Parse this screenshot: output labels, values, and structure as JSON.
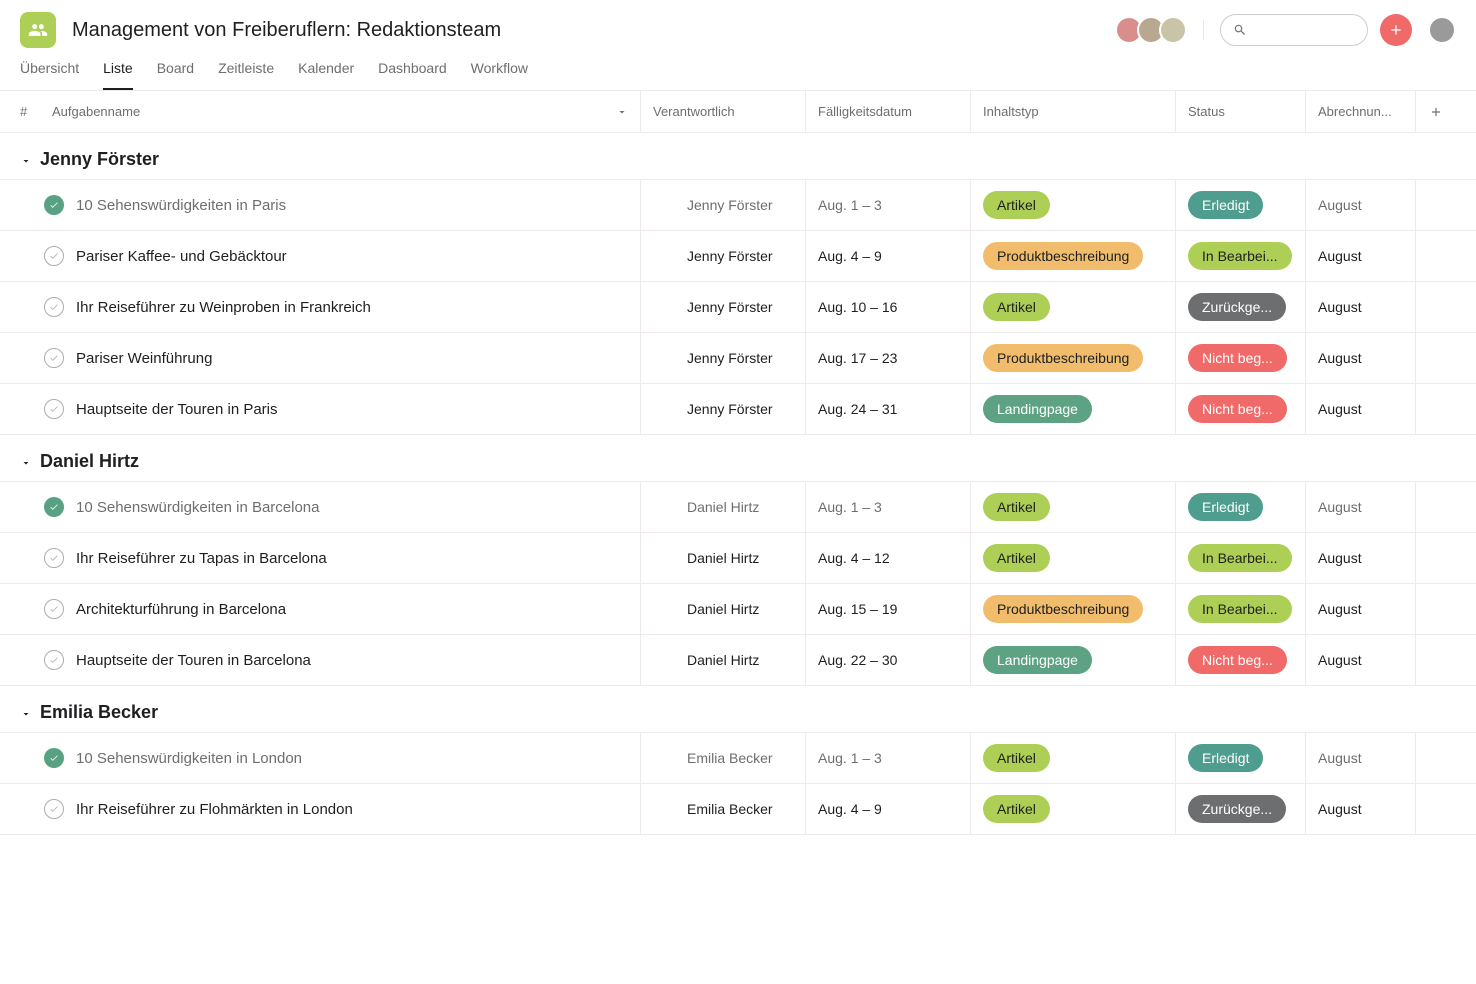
{
  "project": {
    "title": "Management von Freiberuflern: Redaktionsteam"
  },
  "tabs": [
    {
      "label": "Übersicht"
    },
    {
      "label": "Liste"
    },
    {
      "label": "Board"
    },
    {
      "label": "Zeitleiste"
    },
    {
      "label": "Kalender"
    },
    {
      "label": "Dashboard"
    },
    {
      "label": "Workflow"
    }
  ],
  "columns": {
    "hash": "#",
    "name": "Aufgabenname",
    "responsible": "Verantwortlich",
    "due": "Fälligkeitsdatum",
    "content": "Inhaltstyp",
    "status": "Status",
    "billing": "Abrechnun..."
  },
  "sections": [
    {
      "name": "Jenny Förster",
      "avatar_class": "av-jenny",
      "tasks": [
        {
          "done": true,
          "name": "10 Sehenswürdigkeiten in Paris",
          "assignee": "Jenny Förster",
          "due": "Aug. 1 – 3",
          "content_type": "Artikel",
          "content_class": "artikel",
          "status": "Erledigt",
          "status_class": "erledigt",
          "billing": "August"
        },
        {
          "done": false,
          "name": "Pariser Kaffee- und Gebäcktour",
          "assignee": "Jenny Förster",
          "due": "Aug. 4 – 9",
          "content_type": "Produktbeschreibung",
          "content_class": "produkt",
          "status": "In Bearbei...",
          "status_class": "bearbeitung",
          "billing": "August"
        },
        {
          "done": false,
          "name": "Ihr Reiseführer zu Weinproben in Frankreich",
          "assignee": "Jenny Förster",
          "due": "Aug. 10 – 16",
          "content_type": "Artikel",
          "content_class": "artikel",
          "status": "Zurückge...",
          "status_class": "zurueck",
          "billing": "August"
        },
        {
          "done": false,
          "name": "Pariser Weinführung",
          "assignee": "Jenny Förster",
          "due": "Aug. 17 – 23",
          "content_type": "Produktbeschreibung",
          "content_class": "produkt",
          "status": "Nicht beg...",
          "status_class": "nichtbeg",
          "billing": "August"
        },
        {
          "done": false,
          "name": "Hauptseite der Touren in Paris",
          "assignee": "Jenny Förster",
          "due": "Aug. 24 – 31",
          "content_type": "Landingpage",
          "content_class": "landing",
          "status": "Nicht beg...",
          "status_class": "nichtbeg",
          "billing": "August"
        }
      ]
    },
    {
      "name": "Daniel Hirtz",
      "avatar_class": "av-daniel",
      "tasks": [
        {
          "done": true,
          "name": "10 Sehenswürdigkeiten in Barcelona",
          "assignee": "Daniel Hirtz",
          "due": "Aug. 1 – 3",
          "content_type": "Artikel",
          "content_class": "artikel",
          "status": "Erledigt",
          "status_class": "erledigt",
          "billing": "August"
        },
        {
          "done": false,
          "name": "Ihr Reiseführer zu Tapas in Barcelona",
          "assignee": "Daniel Hirtz",
          "due": "Aug. 4 – 12",
          "content_type": "Artikel",
          "content_class": "artikel",
          "status": "In Bearbei...",
          "status_class": "bearbeitung",
          "billing": "August"
        },
        {
          "done": false,
          "name": "Architekturführung in Barcelona",
          "assignee": "Daniel Hirtz",
          "due": "Aug. 15 – 19",
          "content_type": "Produktbeschreibung",
          "content_class": "produkt",
          "status": "In Bearbei...",
          "status_class": "bearbeitung",
          "billing": "August"
        },
        {
          "done": false,
          "name": "Hauptseite der Touren in Barcelona",
          "assignee": "Daniel Hirtz",
          "due": "Aug. 22 – 30",
          "content_type": "Landingpage",
          "content_class": "landing",
          "status": "Nicht beg...",
          "status_class": "nichtbeg",
          "billing": "August"
        }
      ]
    },
    {
      "name": "Emilia Becker",
      "avatar_class": "av-emilia",
      "tasks": [
        {
          "done": true,
          "name": "10 Sehenswürdigkeiten in London",
          "assignee": "Emilia Becker",
          "due": "Aug. 1 – 3",
          "content_type": "Artikel",
          "content_class": "artikel",
          "status": "Erledigt",
          "status_class": "erledigt",
          "billing": "August"
        },
        {
          "done": false,
          "name": "Ihr Reiseführer zu Flohmärkten in London",
          "assignee": "Emilia Becker",
          "due": "Aug. 4 – 9",
          "content_type": "Artikel",
          "content_class": "artikel",
          "status": "Zurückge...",
          "status_class": "zurueck",
          "billing": "August"
        }
      ]
    }
  ]
}
